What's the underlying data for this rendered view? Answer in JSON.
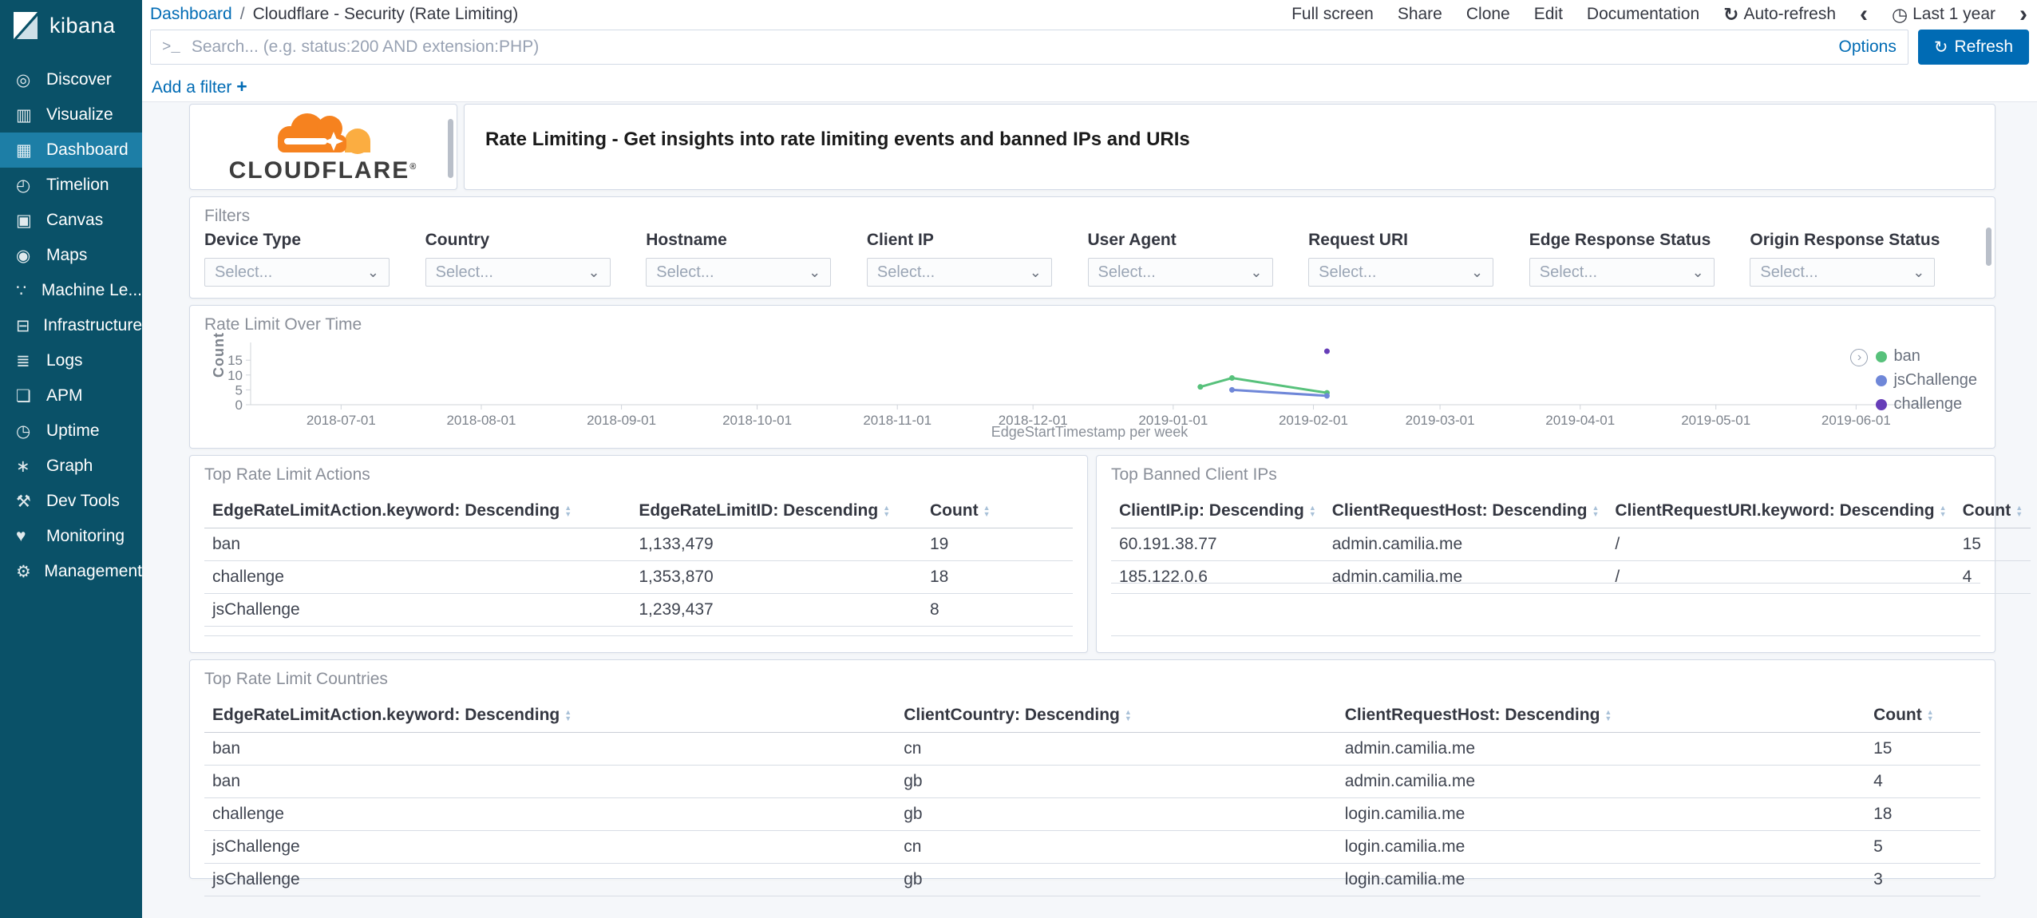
{
  "colors": {
    "accent_blue": "#006bb4",
    "sidebar_bg": "#0a5168",
    "sidebar_selected_bg": "#1d7ea6",
    "page_bg": "#f5f7fa",
    "panel_border": "#d3dae6",
    "series_green": "#57c17b",
    "series_blue": "#6f87d8",
    "series_purple": "#663db8",
    "cloudflare_orange": "#f6821f",
    "cloudflare_light_orange": "#fbad41"
  },
  "sidebar": {
    "product": "kibana",
    "items": [
      {
        "label": "Discover",
        "icon": "◎"
      },
      {
        "label": "Visualize",
        "icon": "▥"
      },
      {
        "label": "Dashboard",
        "icon": "▦"
      },
      {
        "label": "Timelion",
        "icon": "◴"
      },
      {
        "label": "Canvas",
        "icon": "▣"
      },
      {
        "label": "Maps",
        "icon": "◉"
      },
      {
        "label": "Machine Le...",
        "icon": "∵"
      },
      {
        "label": "Infrastructure",
        "icon": "⊟"
      },
      {
        "label": "Logs",
        "icon": "≣"
      },
      {
        "label": "APM",
        "icon": "❏"
      },
      {
        "label": "Uptime",
        "icon": "◷"
      },
      {
        "label": "Graph",
        "icon": "∗"
      },
      {
        "label": "Dev Tools",
        "icon": "⚒"
      },
      {
        "label": "Monitoring",
        "icon": "♥"
      },
      {
        "label": "Management",
        "icon": "⚙"
      }
    ]
  },
  "topbar": {
    "breadcrumb_root": "Dashboard",
    "breadcrumb_sep": "/",
    "breadcrumb_current": "Cloudflare - Security (Rate Limiting)",
    "menu": {
      "full_screen": "Full screen",
      "share": "Share",
      "clone": "Clone",
      "edit": "Edit",
      "documentation": "Documentation",
      "auto_refresh_icon": "↻",
      "auto_refresh": "Auto-refresh",
      "prev_icon": "‹",
      "clock_icon": "◷",
      "time_range": "Last 1 year",
      "next_icon": "›"
    }
  },
  "search": {
    "prompt_icon": ">_",
    "placeholder": "Search... (e.g. status:200 AND extension:PHP)",
    "options_label": "Options",
    "refresh_icon": "↻",
    "refresh_label": "Refresh"
  },
  "filter_bar": {
    "add_filter_label": "Add a filter",
    "plus_icon": "+"
  },
  "panels": {
    "logo": {
      "brand": "CLOUDFLARE",
      "registered_mark": "®"
    },
    "title": {
      "text": "Rate Limiting - Get insights into rate limiting events and banned IPs and URIs"
    },
    "filters": {
      "title": "Filters",
      "fields": [
        {
          "label": "Device Type",
          "value": "Select...",
          "caret": "⌄"
        },
        {
          "label": "Country",
          "value": "Select...",
          "caret": "⌄"
        },
        {
          "label": "Hostname",
          "value": "Select...",
          "caret": "⌄"
        },
        {
          "label": "Client IP",
          "value": "Select...",
          "caret": "⌄"
        },
        {
          "label": "User Agent",
          "value": "Select...",
          "caret": "⌄"
        },
        {
          "label": "Request URI",
          "value": "Select...",
          "caret": "⌄"
        },
        {
          "label": "Edge Response Status",
          "value": "Select...",
          "caret": "⌄"
        },
        {
          "label": "Origin Response Status",
          "value": "Select...",
          "caret": "⌄"
        }
      ]
    },
    "chart": {
      "title": "Rate Limit Over Time",
      "legend_expand_icon": "›"
    },
    "actions_table": {
      "title": "Top Rate Limit Actions",
      "columns": [
        "EdgeRateLimitAction.keyword: Descending",
        "EdgeRateLimitID: Descending",
        "Count"
      ],
      "rows": [
        [
          "ban",
          "1,133,479",
          "19"
        ],
        [
          "challenge",
          "1,353,870",
          "18"
        ],
        [
          "jsChallenge",
          "1,239,437",
          "8"
        ]
      ]
    },
    "banned_ips_table": {
      "title": "Top Banned Client IPs",
      "columns": [
        "ClientIP.ip: Descending",
        "ClientRequestHost: Descending",
        "ClientRequestURI.keyword: Descending",
        "Count"
      ],
      "rows": [
        [
          "60.191.38.77",
          "admin.camilia.me",
          "/",
          "15"
        ],
        [
          "185.122.0.6",
          "admin.camilia.me",
          "/",
          "4"
        ]
      ]
    },
    "countries_table": {
      "title": "Top Rate Limit Countries",
      "columns": [
        "EdgeRateLimitAction.keyword: Descending",
        "ClientCountry: Descending",
        "ClientRequestHost: Descending",
        "Count"
      ],
      "rows": [
        [
          "ban",
          "cn",
          "admin.camilia.me",
          "15"
        ],
        [
          "ban",
          "gb",
          "admin.camilia.me",
          "4"
        ],
        [
          "challenge",
          "gb",
          "login.camilia.me",
          "18"
        ],
        [
          "jsChallenge",
          "cn",
          "login.camilia.me",
          "5"
        ],
        [
          "jsChallenge",
          "gb",
          "login.camilia.me",
          "3"
        ]
      ]
    }
  },
  "chart_data": {
    "type": "line",
    "title": "Rate Limit Over Time",
    "xlabel": "EdgeStartTimestamp per week",
    "ylabel": "Count",
    "ylim": [
      0,
      20
    ],
    "yticks": [
      0,
      5,
      10,
      15
    ],
    "x_domain": [
      "2018-06-11",
      "2019-06-17"
    ],
    "xticks": [
      "2018-07-01",
      "2018-08-01",
      "2018-09-01",
      "2018-10-01",
      "2018-11-01",
      "2018-12-01",
      "2019-01-01",
      "2019-02-01",
      "2019-03-01",
      "2019-04-01",
      "2019-05-01",
      "2019-06-01"
    ],
    "grid": false,
    "legend_position": "right",
    "series": [
      {
        "name": "ban",
        "color": "#57c17b",
        "points": [
          [
            "2019-01-07",
            6
          ],
          [
            "2019-01-14",
            9
          ],
          [
            "2019-02-04",
            4
          ]
        ]
      },
      {
        "name": "jsChallenge",
        "color": "#6f87d8",
        "points": [
          [
            "2019-01-14",
            5
          ],
          [
            "2019-02-04",
            3
          ]
        ]
      },
      {
        "name": "challenge",
        "color": "#663db8",
        "points": [
          [
            "2019-02-04",
            18
          ]
        ]
      }
    ]
  }
}
